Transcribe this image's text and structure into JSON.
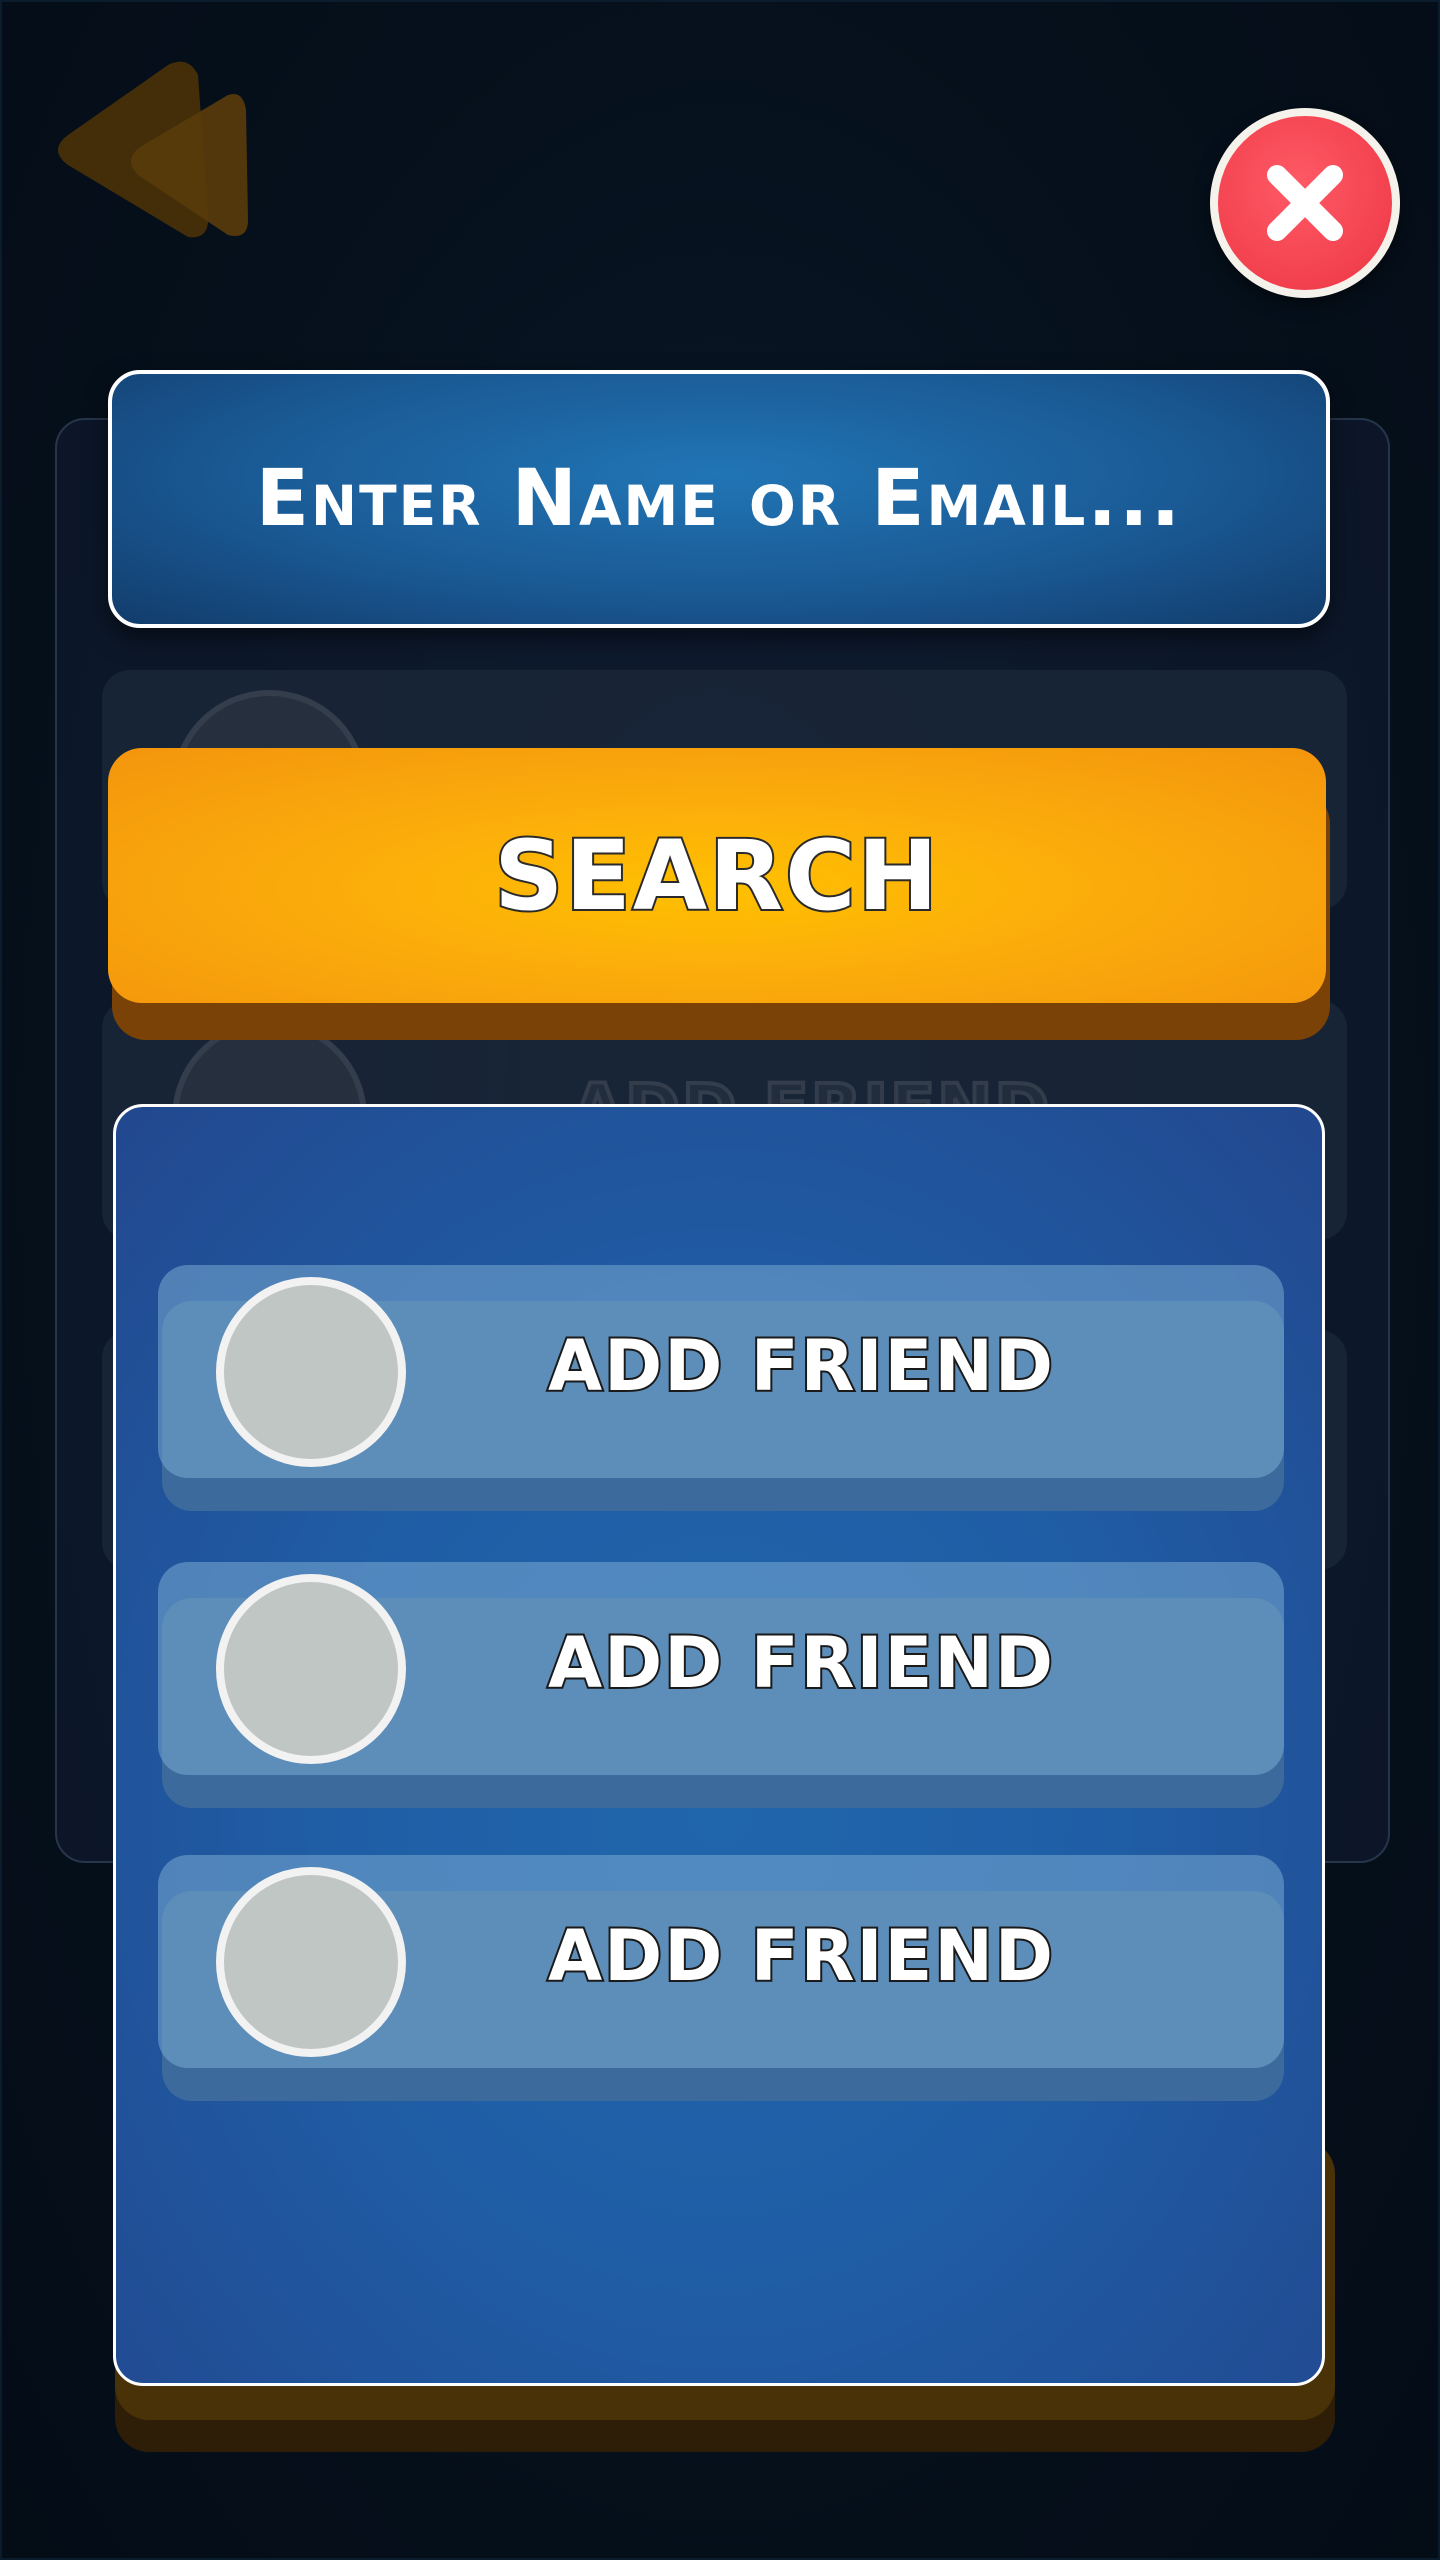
{
  "header": {
    "back_icon": "double-chevron-left-icon",
    "close_icon": "x-icon",
    "close_color": "#f2404e"
  },
  "search": {
    "placeholder": "Enter Name or Email...",
    "button_label": "SEARCH",
    "button_color": "#fbac0b"
  },
  "background_list": {
    "items": [
      {
        "label": ""
      },
      {
        "label": "ADD FRIEND"
      },
      {
        "label": ""
      }
    ]
  },
  "results": {
    "items": [
      {
        "action_label": "ADD FRIEND"
      },
      {
        "action_label": "ADD FRIEND"
      },
      {
        "action_label": "ADD FRIEND"
      }
    ]
  }
}
